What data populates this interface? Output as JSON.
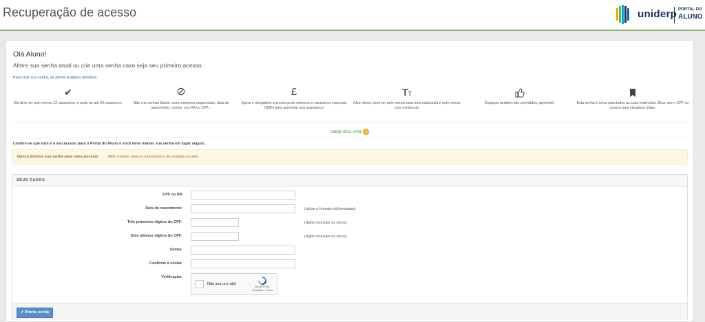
{
  "header": {
    "title": "Recuperação de acesso",
    "brand": "uniderp",
    "portal_small": "PORTAL DO",
    "portal_big": "ALUNO",
    "colors": {
      "border": "#8cb369",
      "brand": "#1d2f5c"
    }
  },
  "intro": {
    "greeting": "Olá Aluno!",
    "subtitle": "Altere sua senha atual ou crie uma senha caso seja seu primeiro acesso.",
    "tips_link": "Para criar sua senha, se atente à alguns detalhes:"
  },
  "tips": [
    {
      "icon": "check-icon",
      "glyph": "✔",
      "text": "Ela deve ter pelo menos 12 caracteres, e pode ter até 20 caracteres."
    },
    {
      "icon": "ban-icon",
      "glyph": "⊘",
      "text": "Não crie senhas fáceis, como números sequenciais, data de nascimento, nomes, seu RA ou CPF..."
    },
    {
      "icon": "pound-icon",
      "glyph": "£",
      "text": "Agora é obrigatório a presença de números e caracteres especiais !@$% para aumentar sua segurança!"
    },
    {
      "icon": "text-height-icon",
      "glyph": "T",
      "text": "Além disso, deve ter pelo menos uma letra maiúscula e pelo menos uma minúscula."
    },
    {
      "icon": "thumbs-up-icon",
      "glyph": "👍",
      "text": "Espaços também são permitidos, aproveite!"
    },
    {
      "icon": "bookmark-icon",
      "glyph": "🔖",
      "text": "Esta senha é única para todos as suas matrículas. Dica: use o CPF no acesso para visualizar todas."
    }
  ],
  "example": "S@j@ cR1a_tIV@",
  "remember": "Lembre-se que este é o seu acesso para o Portal do Aluno e você deve manter sua senha em lugar seguro.",
  "alert": {
    "strong": "Nunca informe sua senha para outra pessoa!",
    "rest": "Nem mesmo para os funcionários da unidade ou polo."
  },
  "form": {
    "heading": "SEUS DADOS",
    "fields": [
      {
        "label": "CPF ou RA",
        "value": "",
        "hint": ""
      },
      {
        "label": "Data de nascimento:",
        "value": "",
        "hint": "(utilize o formato dd/mm/aaaa)"
      },
      {
        "label": "Três primeiros dígitos do CPF:",
        "value": "",
        "hint": "(digite inclusive os zeros)"
      },
      {
        "label": "Dois últimos dígitos do CPF:",
        "value": "",
        "hint": "(digite inclusive os zeros)"
      },
      {
        "label": "Senha:",
        "value": "",
        "hint": ""
      },
      {
        "label": "Confirme a senha:",
        "value": "",
        "hint": ""
      }
    ],
    "verification_label": "Verificação:",
    "captcha": {
      "label": "Não sou um robô",
      "brand": "reCAPTCHA",
      "links": "Privacidade - Termos"
    },
    "submit": "Alterar senha"
  }
}
